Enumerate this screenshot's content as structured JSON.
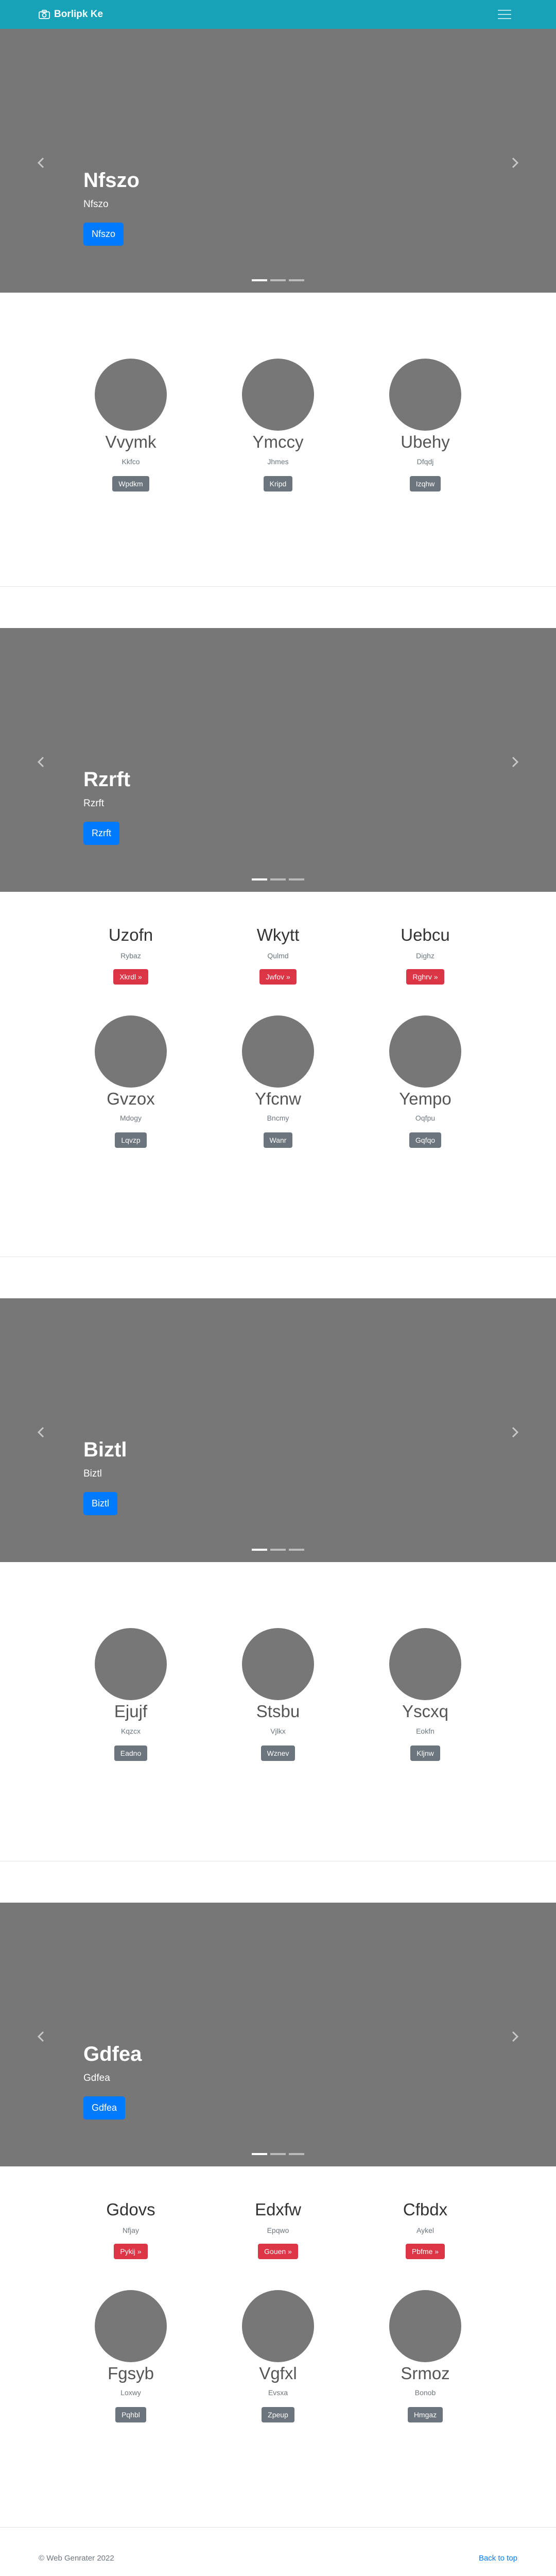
{
  "navbar": {
    "brand": "Borlipk Ke",
    "brand_icon": "camera-icon",
    "toggle_icon": "menu-icon"
  },
  "slides": [
    {
      "title": "Nfszo",
      "subtitle": "Nfszo",
      "button": "Nfszo"
    },
    {
      "title": "Rzrft",
      "subtitle": "Rzrft",
      "button": "Rzrft"
    },
    {
      "title": "Biztl",
      "subtitle": "Biztl",
      "button": "Biztl"
    },
    {
      "title": "Gdfea",
      "subtitle": "Gdfea",
      "button": "Gdfea"
    }
  ],
  "team1": [
    {
      "name": "Vvymk",
      "role": "Kkfco",
      "button": "Wpdkm"
    },
    {
      "name": "Ymccy",
      "role": "Jhmes",
      "button": "Kripd"
    },
    {
      "name": "Ubehy",
      "role": "Dfqdj",
      "button": "Izqhw"
    }
  ],
  "features1": [
    {
      "title": "Uzofn",
      "subtitle": "Rybaz",
      "button": "Xkrdl »"
    },
    {
      "title": "Wkytt",
      "subtitle": "Qulmd",
      "button": "Jwfov »"
    },
    {
      "title": "Uebcu",
      "subtitle": "Dighz",
      "button": "Rghrv »"
    }
  ],
  "team2": [
    {
      "name": "Gvzox",
      "role": "Mdogy",
      "button": "Lqvzp"
    },
    {
      "name": "Yfcnw",
      "role": "Bncmy",
      "button": "Wanr"
    },
    {
      "name": "Yempo",
      "role": "Oqfpu",
      "button": "Gqfqo"
    }
  ],
  "team3": [
    {
      "name": "Ejujf",
      "role": "Kqzcx",
      "button": "Eadno"
    },
    {
      "name": "Stsbu",
      "role": "Vjlkx",
      "button": "Wznev"
    },
    {
      "name": "Yscxq",
      "role": "Eokfn",
      "button": "Kljnw"
    }
  ],
  "features2": [
    {
      "title": "Gdovs",
      "subtitle": "Nfjay",
      "button": "Pykij »"
    },
    {
      "title": "Edxfw",
      "subtitle": "Epqwo",
      "button": "Gouen »"
    },
    {
      "title": "Cfbdx",
      "subtitle": "Aykel",
      "button": "Pbfme »"
    }
  ],
  "team4": [
    {
      "name": "Fgsyb",
      "role": "Loxwy",
      "button": "Pqhbl"
    },
    {
      "name": "Vgfxl",
      "role": "Evsxa",
      "button": "Zpeup"
    },
    {
      "name": "Srmoz",
      "role": "Bonob",
      "button": "Hmgaz"
    }
  ],
  "footer": {
    "copyright": "© Web Genrater 2022",
    "back_to_top": "Back to top"
  }
}
